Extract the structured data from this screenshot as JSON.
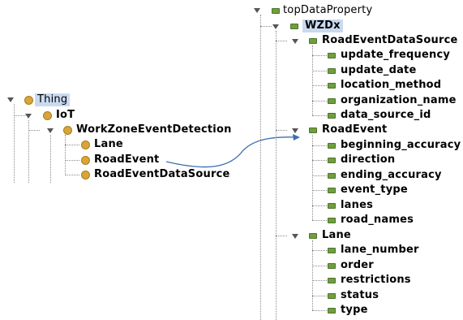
{
  "class_tree": {
    "root": "Thing",
    "iot": "IoT",
    "workzone": "WorkZoneEventDetection",
    "children": [
      "Lane",
      "RoadEvent",
      "RoadEventDataSource"
    ]
  },
  "property_tree": {
    "root": "topDataProperty",
    "wzdx": "WZDx",
    "groups": [
      {
        "name": "RoadEventDataSource",
        "items": [
          "update_frequency",
          "update_date",
          "location_method",
          "organization_name",
          "data_source_id"
        ]
      },
      {
        "name": "RoadEvent",
        "items": [
          "beginning_accuracy",
          "direction",
          "ending_accuracy",
          "event_type",
          "lanes",
          "road_names"
        ]
      },
      {
        "name": "Lane",
        "items": [
          "lane_number",
          "order",
          "restrictions",
          "status",
          "type"
        ]
      }
    ]
  },
  "colors": {
    "class_icon": "#d7a539",
    "property_icon": "#6f9e3f",
    "selection": "#c9daf0",
    "arrow": "#3c6eb4"
  }
}
